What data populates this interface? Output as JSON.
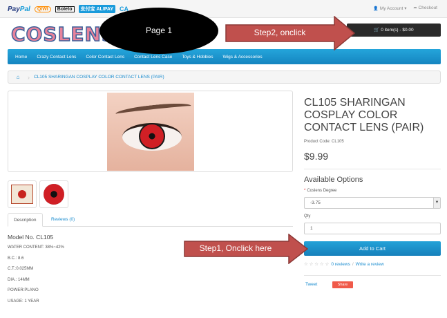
{
  "topbar": {
    "payment_logos": [
      "PayPal",
      "QIWI",
      "Boleto",
      "支付宝 ALIPAY",
      "CA"
    ],
    "my_account": "My Account",
    "checkout": "Checkout"
  },
  "header": {
    "logo_text": "COSLENS",
    "cart_label": "0 item(s) - $0.00"
  },
  "annotations": {
    "page": "Page 1",
    "step2": "Step2, onclick",
    "step1": "Step1, Onclick here"
  },
  "nav": {
    "items": [
      "Home",
      "Crazy Contact Lens",
      "Color Contact Lens",
      "Contact Lens Case",
      "Toys & Hobbies",
      "Wigs & Accessories"
    ]
  },
  "breadcrumb": {
    "current": "CL105 SHARINGAN COSPLAY COLOR CONTACT LENS (PAIR)"
  },
  "tabs": {
    "description": "Description",
    "reviews": "Reviews (0)"
  },
  "description": {
    "model": "Model No. CL105",
    "lines": [
      "WATER CONTENT: 38%~42%",
      "B.C.: 8.6",
      "C.T.:0.025MM",
      "DIA.: 14MM",
      "POWER:PLANO",
      "USAGE: 1 YEAR"
    ]
  },
  "product": {
    "title": "CL105 SHARINGAN COSPLAY COLOR CONTACT LENS (PAIR)",
    "code": "Product Code: CL105",
    "price": "$9.99",
    "options_title": "Available Options",
    "option_label": "Coslens Degree",
    "option_value": "-3.75",
    "qty_label": "Qty",
    "qty_value": "1",
    "add_to_cart": "Add to Cart",
    "reviews_link": "0 reviews",
    "write_review": "Write a review",
    "tweet": "Tweet",
    "share": "Share"
  },
  "colors": {
    "nav_blue": "#1a95d1",
    "arrow_fill": "#c0504d",
    "lens_red": "#d01f25"
  }
}
